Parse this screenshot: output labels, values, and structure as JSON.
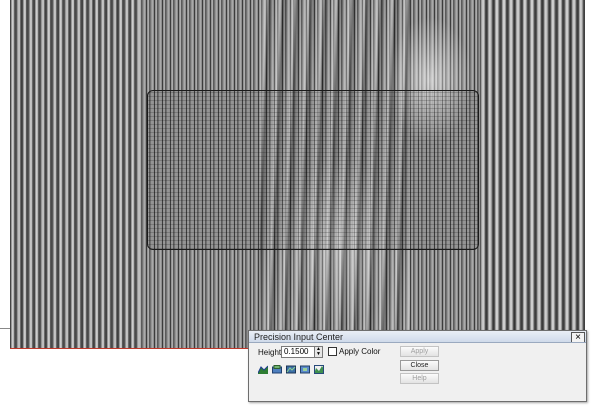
{
  "dialog": {
    "title": "Precision Input Center",
    "close_glyph": "×",
    "height_label": "Height",
    "height_value": "0.1500",
    "apply_color_label": "Apply Color",
    "apply_color_checked": false,
    "buttons": {
      "apply": "Apply",
      "close": "Close",
      "help": "Help"
    },
    "tool_icons": [
      "relief-tool-1-icon",
      "relief-tool-2-icon",
      "relief-tool-3-icon",
      "relief-tool-4-icon",
      "relief-tool-5-icon"
    ]
  },
  "colors": {
    "titlebar": "#cfdaea",
    "dialog_bg": "#f0f0f0",
    "accent_line": "#c0392b"
  }
}
